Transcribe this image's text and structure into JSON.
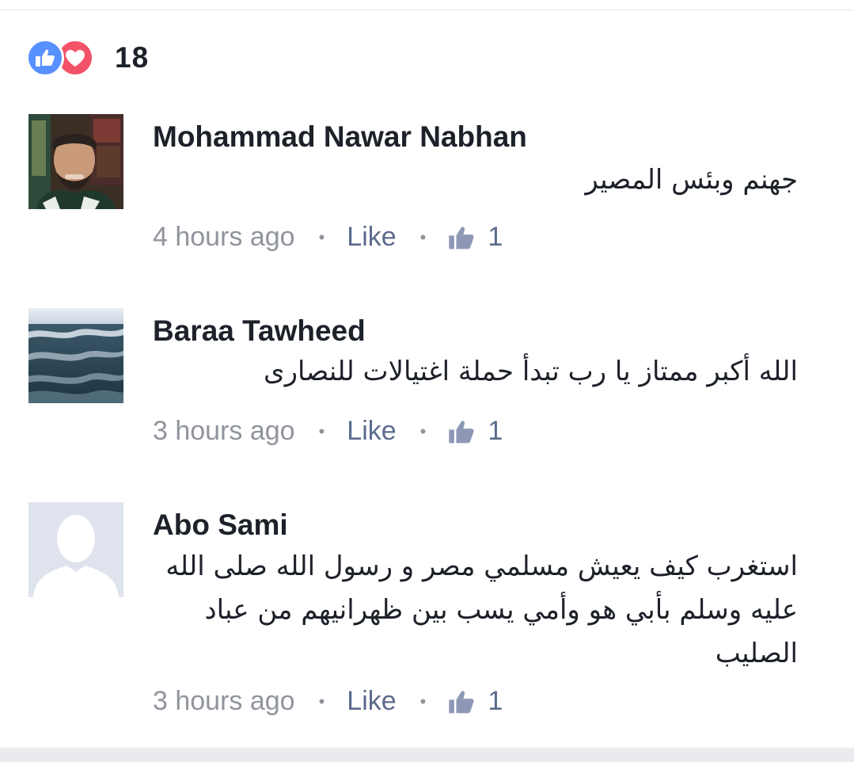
{
  "reactions": {
    "count": "18",
    "icons": [
      "like-icon",
      "love-icon"
    ],
    "like_color": "#5890ff",
    "love_color": "#f25268"
  },
  "comments": [
    {
      "author": "Mohammad Nawar Nabhan",
      "text": "جهنم وبئس المصير",
      "time": "4 hours ago",
      "like_label": "Like",
      "like_count": "1",
      "avatar": "photo-man-beard"
    },
    {
      "author": "Baraa Tawheed",
      "text": "الله أكبر ممتاز يا رب تبدأ حملة اغتيالات للنصارى",
      "time": "3 hours ago",
      "like_label": "Like",
      "like_count": "1",
      "avatar": "photo-sea-waves"
    },
    {
      "author": "Abo Sami",
      "text": "استغرب كيف يعيش مسلمي مصر و رسول الله صلى الله عليه وسلم بأبي هو وأمي يسب بين ظهرانيهم من عباد الصليب",
      "time": "3 hours ago",
      "like_label": "Like",
      "like_count": "1",
      "avatar": "default-silhouette"
    }
  ],
  "colors": {
    "text": "#1d2129",
    "meta": "#90949c",
    "link": "#5b6b8c",
    "divider": "#e9ebee"
  }
}
